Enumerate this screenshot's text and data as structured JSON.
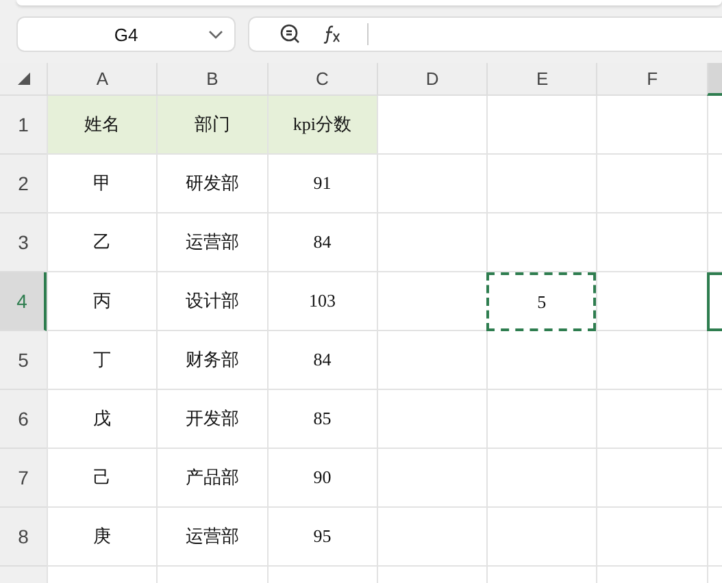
{
  "name_box": {
    "value": "G4"
  },
  "columns": [
    {
      "label": "A",
      "selected": false
    },
    {
      "label": "B",
      "selected": false
    },
    {
      "label": "C",
      "selected": false
    },
    {
      "label": "D",
      "selected": false
    },
    {
      "label": "E",
      "selected": false
    },
    {
      "label": "F",
      "selected": false
    },
    {
      "selected": true
    }
  ],
  "rows": [
    {
      "number": "1",
      "selected": false,
      "cells": [
        {
          "text": "姓名",
          "filled": true
        },
        {
          "text": "部门",
          "filled": true
        },
        {
          "text": "kpi分数",
          "filled": true
        },
        {},
        {},
        {},
        {}
      ]
    },
    {
      "number": "2",
      "selected": false,
      "cells": [
        {
          "text": "甲"
        },
        {
          "text": "研发部"
        },
        {
          "text": "91"
        },
        {},
        {},
        {},
        {}
      ]
    },
    {
      "number": "3",
      "selected": false,
      "cells": [
        {
          "text": "乙"
        },
        {
          "text": "运营部"
        },
        {
          "text": "84"
        },
        {},
        {},
        {},
        {}
      ]
    },
    {
      "number": "4",
      "selected": true,
      "cells": [
        {
          "text": "丙"
        },
        {
          "text": "设计部"
        },
        {
          "text": "103"
        },
        {},
        {
          "text": "5",
          "marquee": true
        },
        {},
        {
          "selected": true
        }
      ]
    },
    {
      "number": "5",
      "selected": false,
      "cells": [
        {
          "text": "丁"
        },
        {
          "text": "财务部"
        },
        {
          "text": "84"
        },
        {},
        {},
        {},
        {}
      ]
    },
    {
      "number": "6",
      "selected": false,
      "cells": [
        {
          "text": "戊"
        },
        {
          "text": "开发部"
        },
        {
          "text": "85"
        },
        {},
        {},
        {},
        {}
      ]
    },
    {
      "number": "7",
      "selected": false,
      "cells": [
        {
          "text": "己"
        },
        {
          "text": "产品部"
        },
        {
          "text": "90"
        },
        {},
        {},
        {},
        {}
      ]
    },
    {
      "number": "8",
      "selected": false,
      "cells": [
        {
          "text": "庚"
        },
        {
          "text": "运营部"
        },
        {
          "text": "95"
        },
        {},
        {},
        {},
        {}
      ]
    },
    {
      "selected": false,
      "cells": [
        {},
        {},
        {},
        {},
        {},
        {},
        {}
      ]
    }
  ]
}
